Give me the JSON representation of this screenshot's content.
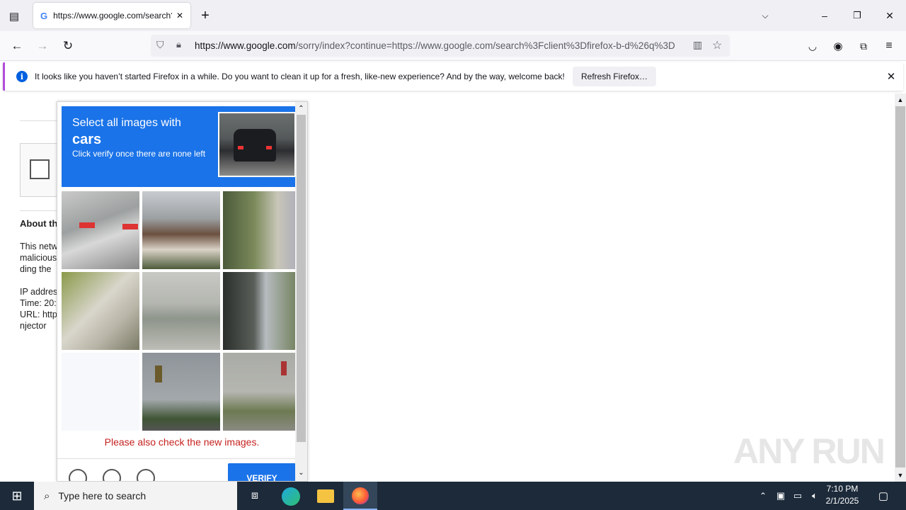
{
  "browser": {
    "tab_title": "https://www.google.com/search?q=",
    "url_domain": "https://www.google.com",
    "url_rest": "/sorry/index?continue=https://www.google.com/search%3Fclient%3Dfirefox-b-d%26q%3D",
    "new_tab": "+",
    "window_controls": {
      "minimize": "–",
      "restore": "❐",
      "close": "✕"
    }
  },
  "notification": {
    "text": "It looks like you haven’t started Firefox in a while. Do you want to clean it up for a fresh, like-new experience? And by the way, welcome back!",
    "button": "Refresh Firefox…",
    "close": "✕"
  },
  "page_background": {
    "about_heading": "About th",
    "lines": [
      "This netw",
      "malicious",
      "ding the",
      "",
      "IP addres",
      "Time: 20:",
      "URL: http",
      "njector"
    ]
  },
  "captcha": {
    "instruction_1": "Select all images with",
    "target": "cars",
    "instruction_2": "Click verify once there are none left",
    "message": "Please also check the new images.",
    "verify_label": "VERIFY"
  },
  "taskbar": {
    "search_placeholder": "Type here to search",
    "time": "7:10 PM",
    "date": "2/1/2025"
  },
  "watermark": "ANY RUN"
}
